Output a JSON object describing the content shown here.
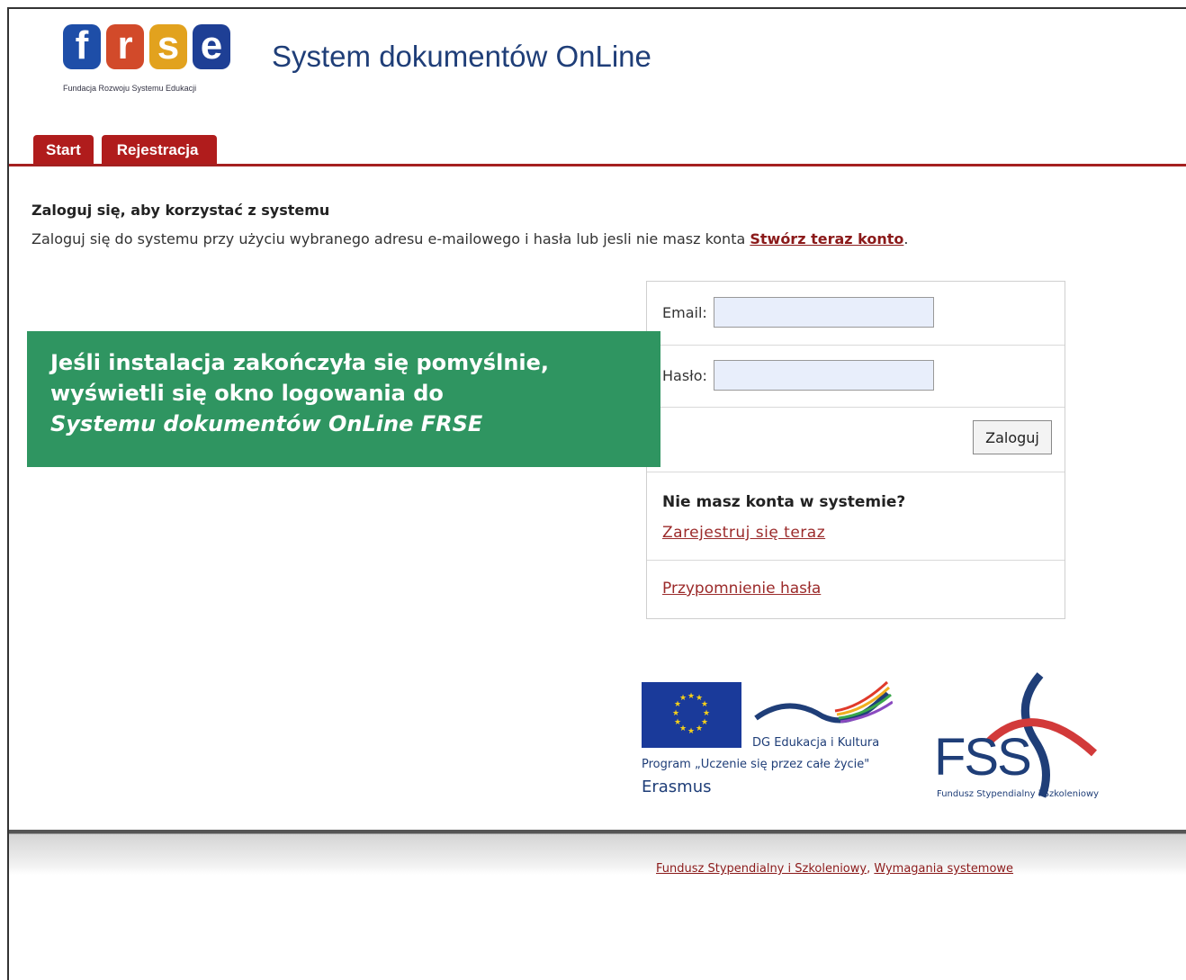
{
  "header": {
    "logo_letters": [
      "f",
      "r",
      "s",
      "e"
    ],
    "logo_colors": [
      "#1e4ea8",
      "#d24a2a",
      "#e2a21e",
      "#1e3f95"
    ],
    "logo_tagline": "Fundacja Rozwoju Systemu Edukacji",
    "app_title": "System dokumentów OnLine"
  },
  "tabs": [
    {
      "label": "Start"
    },
    {
      "label": "Rejestracja"
    }
  ],
  "intro": {
    "title": "Zaloguj się, aby korzystać z systemu",
    "text": "Zaloguj się do systemu przy użyciu wybranego adresu e-mailowego i hasła lub jesli nie masz konta ",
    "link": "Stwórz teraz konto",
    "suffix": "."
  },
  "login": {
    "email_label": "Email:",
    "email_value": "",
    "password_label": "Hasło:",
    "password_value": "",
    "submit_label": "Zaloguj",
    "no_account": "Nie masz konta w systemie?",
    "register_link": "Zarejestruj się teraz",
    "remind_link": "Przypomnienie hasła"
  },
  "callout": {
    "line1": "Jeśli instalacja zakończyła się pomyślnie,",
    "line2": "wyświetli się okno logowania do",
    "line3": "Systemu dokumentów OnLine FRSE"
  },
  "partners": {
    "dg": "DG Edukacja i Kultura",
    "program": "Program „Uczenie się przez całe życie\"",
    "erasmus": "Erasmus",
    "fss": "FSS",
    "fss_sub": "Fundusz Stypendialny i Szkoleniowy"
  },
  "footer": {
    "link1": "Fundusz Stypendialny i Szkoleniowy",
    "sep": ", ",
    "link2": "Wymagania systemowe"
  },
  "colors": {
    "accent": "#a52020",
    "callout": "#2f9561",
    "brand_blue": "#1f3e78"
  }
}
